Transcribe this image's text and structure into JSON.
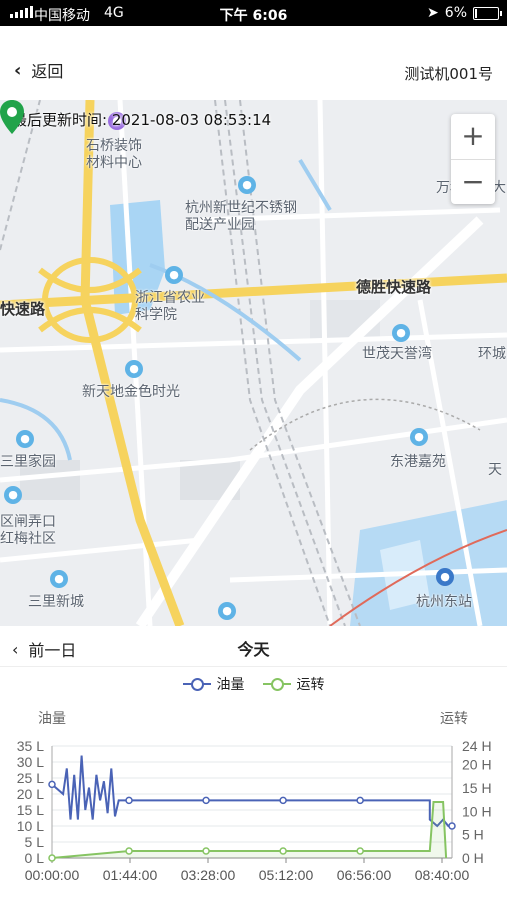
{
  "status_bar": {
    "carrier": "中国移动",
    "network": "4G",
    "time": "下午 6:06",
    "battery": "6%"
  },
  "header": {
    "back_label": "返回",
    "device_name": "测试机001号"
  },
  "map": {
    "last_update_label": "最后更新时间:",
    "last_update_value": "2021-08-03 08:53:14",
    "zoom_in": "+",
    "zoom_out": "−",
    "labels": {
      "shiqiao": "石桥装饰\n材料中心",
      "steel": "杭州新世纪不锈钢\n配送产业园",
      "agri": "浙江省农业\n科学院",
      "xintiandi": "新天地金色时光",
      "maoshi": "世茂天誉湾",
      "huancheng": "环城",
      "sanlijiayuan": "三里家园",
      "zhanong": "区闸弄口\n红梅社区",
      "sanlixincheng": "三里新城",
      "donggang": "东港嘉苑",
      "eaststation": "杭州东站",
      "wanke": "万科公园大",
      "tian": "天",
      "road_desheng": "德胜快速路",
      "road_left": "快速路"
    }
  },
  "day_nav": {
    "prev_label": "前一日",
    "current_label": "今天"
  },
  "chart_data": {
    "type": "line",
    "x": [
      "00:00:00",
      "01:44:00",
      "03:28:00",
      "05:12:00",
      "06:56:00",
      "08:40:00"
    ],
    "series": [
      {
        "name": "油量",
        "color": "#4a63b6",
        "axis": "left",
        "points": [
          [
            0,
            23
          ],
          [
            15,
            20
          ],
          [
            20,
            28
          ],
          [
            25,
            12
          ],
          [
            30,
            26
          ],
          [
            35,
            12
          ],
          [
            40,
            32
          ],
          [
            45,
            15
          ],
          [
            50,
            22
          ],
          [
            55,
            12
          ],
          [
            60,
            26
          ],
          [
            65,
            18
          ],
          [
            70,
            24
          ],
          [
            75,
            14
          ],
          [
            80,
            28
          ],
          [
            85,
            13
          ],
          [
            90,
            18
          ],
          [
            104,
            18
          ],
          [
            208,
            18
          ],
          [
            312,
            18
          ],
          [
            416,
            18
          ],
          [
            510,
            18
          ],
          [
            510,
            12
          ],
          [
            520,
            10
          ],
          [
            528,
            12
          ],
          [
            535,
            10
          ],
          [
            540,
            10
          ]
        ]
      },
      {
        "name": "运转",
        "color": "#86c462",
        "axis": "right",
        "points": [
          [
            0,
            0
          ],
          [
            104,
            1.5
          ],
          [
            208,
            1.5
          ],
          [
            312,
            1.5
          ],
          [
            416,
            1.5
          ],
          [
            510,
            1.5
          ],
          [
            515,
            12
          ],
          [
            520,
            12
          ],
          [
            528,
            12
          ],
          [
            532,
            0
          ]
        ]
      }
    ],
    "y_left": {
      "label": "油量",
      "ticks": [
        "0 L",
        "5 L",
        "10 L",
        "15 L",
        "20 L",
        "25 L",
        "30 L",
        "35 L"
      ],
      "range": [
        0,
        35
      ]
    },
    "y_right": {
      "label": "运转",
      "ticks": [
        "0 H",
        "5 H",
        "10 H",
        "15 H",
        "20 H",
        "24 H"
      ],
      "range": [
        0,
        24
      ]
    },
    "x_range": [
      0,
      540
    ],
    "grid": true
  }
}
